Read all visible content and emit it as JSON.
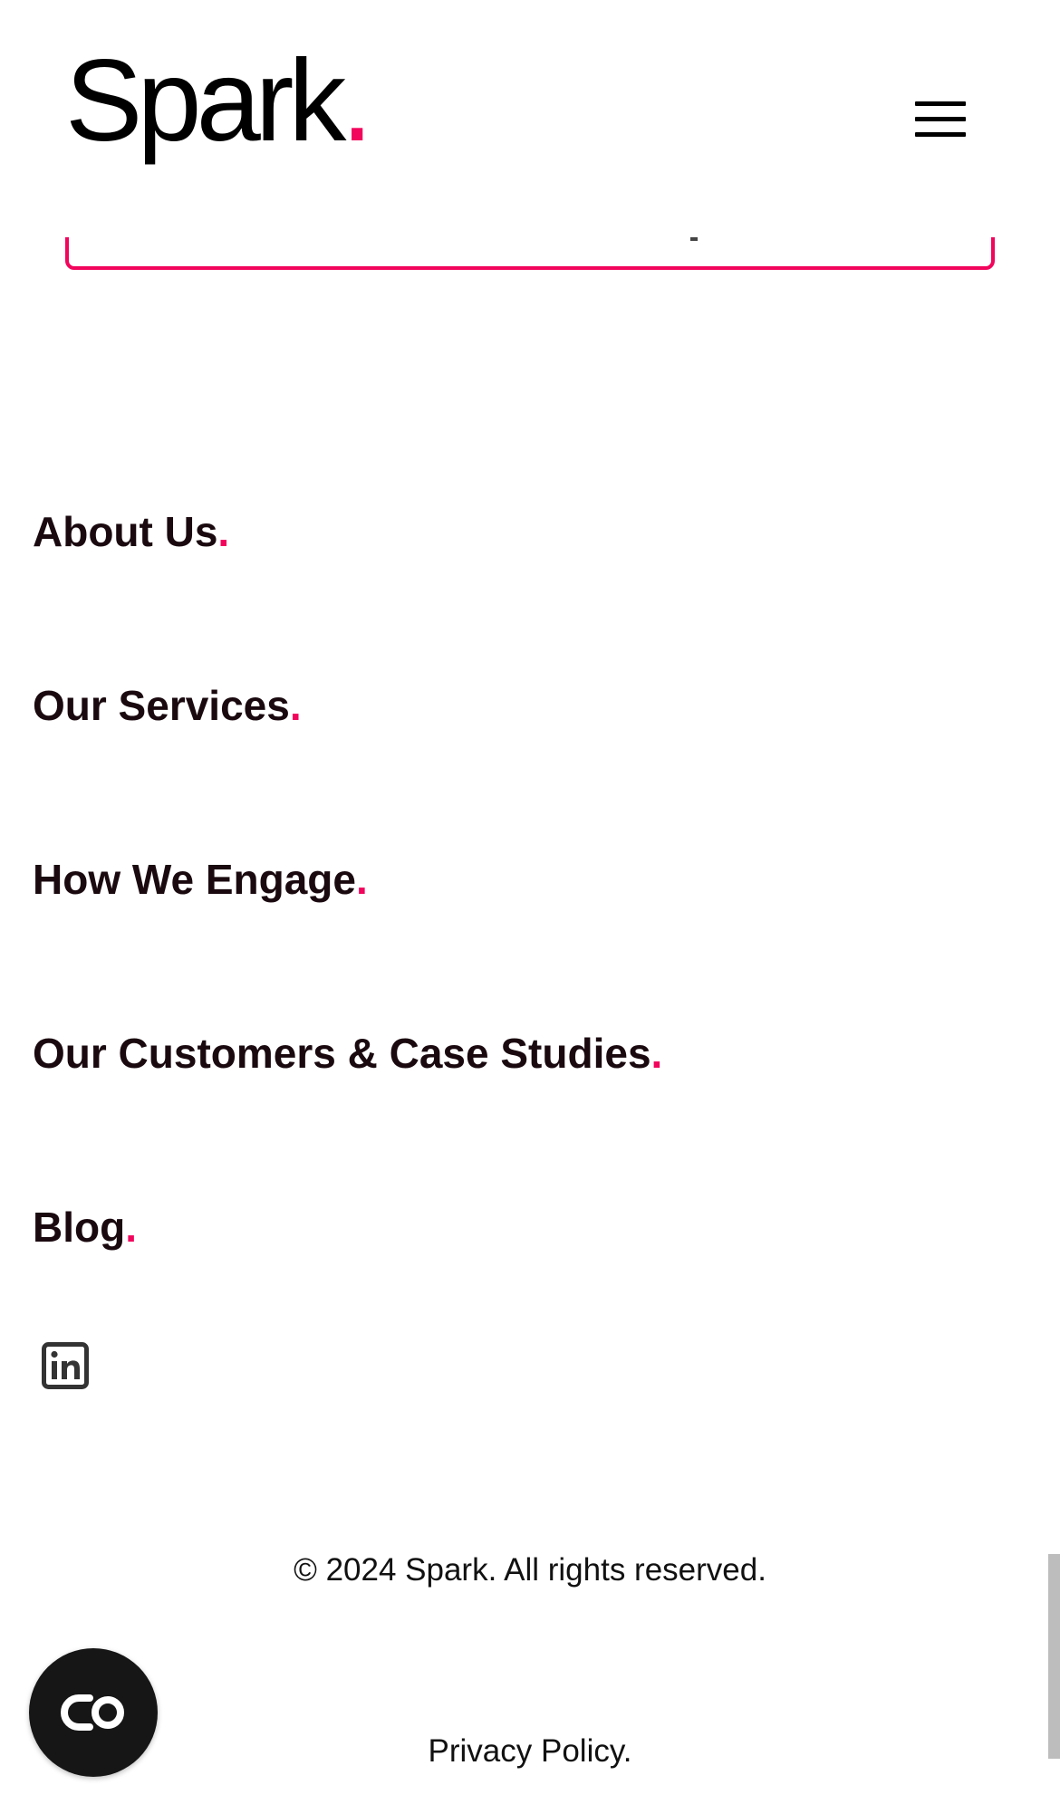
{
  "header": {
    "logo_text": "Spark",
    "logo_dot": "."
  },
  "nav": {
    "items": [
      {
        "label": "About Us",
        "dot": "."
      },
      {
        "label": "Our Services",
        "dot": "."
      },
      {
        "label": "How We Engage",
        "dot": "."
      },
      {
        "label": "Our Customers & Case Studies",
        "dot": "."
      },
      {
        "label": "Blog",
        "dot": "."
      }
    ]
  },
  "social": {
    "icon": "linkedin-icon"
  },
  "footer": {
    "copyright": "© 2024 Spark. All rights reserved.",
    "privacy": "Privacy Policy."
  },
  "chat": {
    "icon": "chat-widget-icon"
  },
  "colors": {
    "accent": "#f2055c",
    "text": "#1a0a0f",
    "chat_bg": "#161616"
  }
}
